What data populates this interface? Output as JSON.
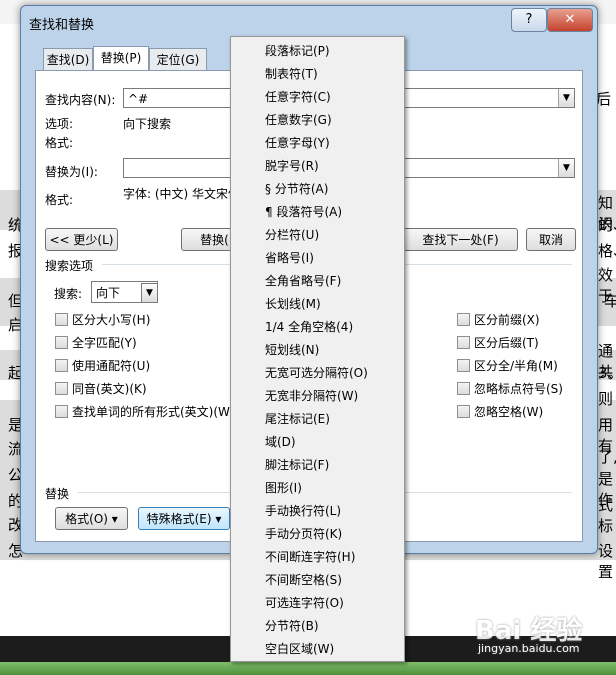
{
  "background": {
    "right_texts": [
      "后",
      "知识",
      "的、",
      "格、",
      "效于",
      "车",
      "通共",
      "3。",
      "则",
      "用有",
      "了,",
      "是作",
      "式标",
      "设置"
    ],
    "left_texts": [
      "统",
      "报",
      "但",
      "启",
      "是",
      "流",
      "公",
      "的",
      "改",
      "怎",
      "起"
    ]
  },
  "dialog": {
    "title": "查找和替换",
    "help_label": "?",
    "close_label": "✕",
    "tabs": [
      "查找(D)",
      "替换(P)",
      "定位(G)"
    ],
    "find_label": "查找内容(N):",
    "find_value": "^#",
    "options_label": "选项:",
    "options_value": "向下搜索",
    "format_label": "格式:",
    "replace_label": "替换为(I):",
    "replace_value": "",
    "replace_format_label": "格式:",
    "replace_format_value": "字体: (中文) 华文宋体",
    "btn_less": "<< 更少(L)",
    "btn_replace": "替换(R)",
    "btn_find_next": "查找下一处(F)",
    "btn_cancel": "取消",
    "search_options_label": "搜索选项",
    "search_label": "搜索:",
    "search_value": "向下",
    "left_checks": [
      "区分大小写(H)",
      "全字匹配(Y)",
      "使用通配符(U)",
      "同音(英文)(K)",
      "查找单词的所有形式(英文)(W)"
    ],
    "right_checks": [
      "区分前缀(X)",
      "区分后缀(T)",
      "区分全/半角(M)",
      "忽略标点符号(S)",
      "忽略空格(W)"
    ],
    "replace_section_label": "替换",
    "btn_format": "格式(O) ▾",
    "btn_special": "特殊格式(E) ▾"
  },
  "menu": {
    "items": [
      "段落标记(P)",
      "制表符(T)",
      "任意字符(C)",
      "任意数字(G)",
      "任意字母(Y)",
      "脱字号(R)",
      "§ 分节符(A)",
      "¶ 段落符号(A)",
      "分栏符(U)",
      "省略号(I)",
      "全角省略号(F)",
      "长划线(M)",
      "1/4 全角空格(4)",
      "短划线(N)",
      "无宽可选分隔符(O)",
      "无宽非分隔符(W)",
      "尾注标记(E)",
      "域(D)",
      "脚注标记(F)",
      "图形(I)",
      "手动换行符(L)",
      "手动分页符(K)",
      "不间断连字符(H)",
      "不间断空格(S)",
      "可选连字符(O)",
      "分节符(B)",
      "空白区域(W)"
    ]
  },
  "watermark": {
    "text": "Bai 经验",
    "url": "jingyan.baidu.com"
  }
}
